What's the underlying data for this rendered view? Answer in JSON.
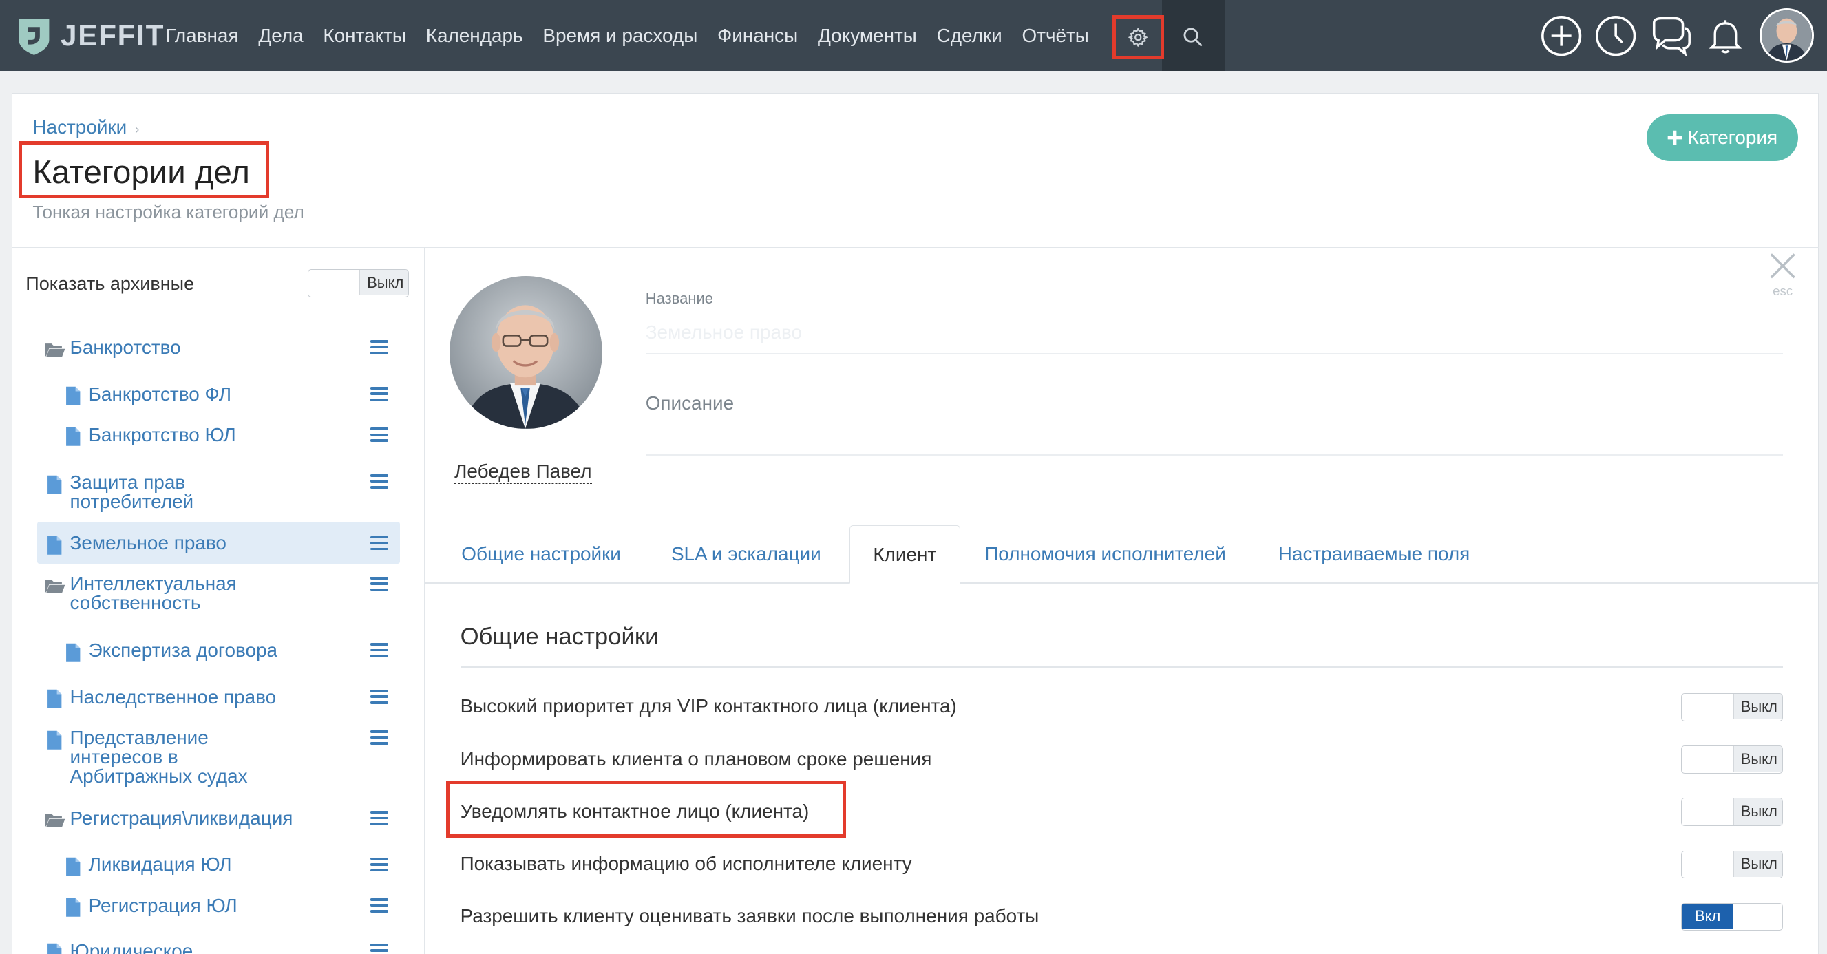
{
  "app": {
    "logo_text": "JEFFIT"
  },
  "nav": {
    "items": [
      "Главная",
      "Дела",
      "Контакты",
      "Календарь",
      "Время и расходы",
      "Финансы",
      "Документы",
      "Сделки",
      "Отчёты"
    ]
  },
  "header": {
    "breadcrumb": "Настройки",
    "title": "Категории дел",
    "subtitle": "Тонкая настройка категорий дел",
    "add_button": "Категория"
  },
  "sidebar": {
    "show_archived_label": "Показать архивные",
    "show_archived_state": "Выкл",
    "items": [
      {
        "label": "Банкротство",
        "type": "folder"
      },
      {
        "label": "Банкротство ФЛ",
        "type": "file"
      },
      {
        "label": "Банкротство ЮЛ",
        "type": "file"
      },
      {
        "label": "Защита прав\nпотребителей",
        "type": "file"
      },
      {
        "label": "Земельное право",
        "type": "file",
        "selected": true
      },
      {
        "label": "Интеллектуальная\nсобственность",
        "type": "folder"
      },
      {
        "label": "Экспертиза договора",
        "type": "file"
      },
      {
        "label": "Наследственное право",
        "type": "file"
      },
      {
        "label": "Представление\nинтересов в\nАрбитражных судах",
        "type": "file"
      },
      {
        "label": "Регистрация\\ликвидация",
        "type": "folder"
      },
      {
        "label": "Ликвидация ЮЛ",
        "type": "file"
      },
      {
        "label": "Регистрация ЮЛ",
        "type": "file"
      },
      {
        "label": "Юридическое",
        "type": "file"
      }
    ]
  },
  "detail": {
    "close_hint": "esc",
    "person_name": "Лебедев Павел",
    "name_label": "Название",
    "name_value": "Земельное право",
    "description_label": "Описание",
    "tabs": [
      "Общие настройки",
      "SLA и эскалации",
      "Клиент",
      "Полномочия исполнителей",
      "Настраиваемые поля"
    ],
    "active_tab": "Клиент",
    "section_title": "Общие настройки",
    "settings": [
      {
        "label": "Высокий приоритет для VIP контактного лица (клиента)",
        "state": "Выкл",
        "on": false
      },
      {
        "label": "Информировать клиента о плановом сроке решения",
        "state": "Выкл",
        "on": false
      },
      {
        "label": "Уведомлять контактное лицо (клиента)",
        "state": "Выкл",
        "on": false
      },
      {
        "label": "Показывать информацию об исполнителе клиенту",
        "state": "Выкл",
        "on": false
      },
      {
        "label": "Разрешить клиенту оценивать заявки после выполнения работы",
        "state": "Вкл",
        "on": true
      }
    ]
  },
  "colors": {
    "accent": "#3b7bb6",
    "topbar": "#3b4650",
    "add_button": "#5bbdb0",
    "highlight": "#e33b2c",
    "toggle_on": "#1d61ad"
  }
}
